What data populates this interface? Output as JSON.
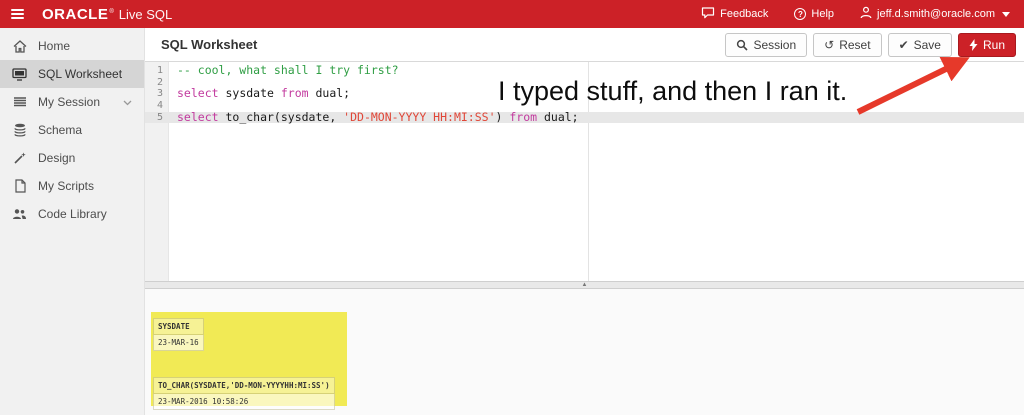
{
  "header": {
    "brand": "ORACLE",
    "brand_mark": "®",
    "brand_suffix": "Live SQL",
    "feedback_label": "Feedback",
    "help_label": "Help",
    "help_glyph": "?",
    "user_email": "jeff.d.smith@oracle.com"
  },
  "sidebar": {
    "items": [
      {
        "label": "Home",
        "icon": "home-icon"
      },
      {
        "label": "SQL Worksheet",
        "icon": "monitor-icon",
        "active": true
      },
      {
        "label": "My Session",
        "icon": "list-icon",
        "has_chevron": true
      },
      {
        "label": "Schema",
        "icon": "database-icon"
      },
      {
        "label": "Design",
        "icon": "wand-icon"
      },
      {
        "label": "My Scripts",
        "icon": "document-icon"
      },
      {
        "label": "Code Library",
        "icon": "people-icon"
      }
    ]
  },
  "toolbar": {
    "title": "SQL Worksheet",
    "buttons": [
      {
        "label": "Session",
        "icon": "search-icon"
      },
      {
        "label": "Reset",
        "glyph": "↺"
      },
      {
        "label": "Save",
        "glyph": "✔"
      },
      {
        "label": "Run",
        "icon": "bolt-icon"
      }
    ]
  },
  "editor": {
    "lines": [
      {
        "num": "1",
        "segments": [
          {
            "t": "-- cool, what shall I try first?",
            "c": "comment"
          }
        ]
      },
      {
        "num": "2",
        "segments": []
      },
      {
        "num": "3",
        "segments": [
          {
            "t": "select",
            "c": "kw"
          },
          {
            "t": " sysdate ",
            "c": "plain"
          },
          {
            "t": "from",
            "c": "kw"
          },
          {
            "t": " dual;",
            "c": "plain"
          }
        ]
      },
      {
        "num": "4",
        "segments": []
      },
      {
        "num": "5",
        "highlighted": true,
        "segments": [
          {
            "t": "select",
            "c": "kw"
          },
          {
            "t": " to_char(sysdate, ",
            "c": "plain"
          },
          {
            "t": "'DD-MON-YYYY HH:MI:SS'",
            "c": "str"
          },
          {
            "t": ") ",
            "c": "plain"
          },
          {
            "t": "from",
            "c": "kw"
          },
          {
            "t": " dual;",
            "c": "plain"
          }
        ]
      }
    ]
  },
  "annotation": {
    "text": "I typed stuff, and then I ran it."
  },
  "splitter": {
    "grip_glyph": "▲"
  },
  "results": {
    "tables": [
      {
        "header": "SYSDATE",
        "value": "23-MAR-16"
      },
      {
        "header": "TO_CHAR(SYSDATE,'DD-MON-YYYYHH:MI:SS')",
        "value": "23-MAR-2016 10:58:26"
      }
    ]
  },
  "colors": {
    "header_red": "#cc2127",
    "run_button_red": "#cc2127",
    "arrow_red": "#e6392a",
    "highlight_yellow": "#f1ea55",
    "active_sidebar_gray": "#d5d5d5",
    "comment_green": "#2f9e44",
    "keyword_magenta": "#c23a9e",
    "string_red": "#e04637",
    "active_line_gray": "#e7e7e7"
  }
}
